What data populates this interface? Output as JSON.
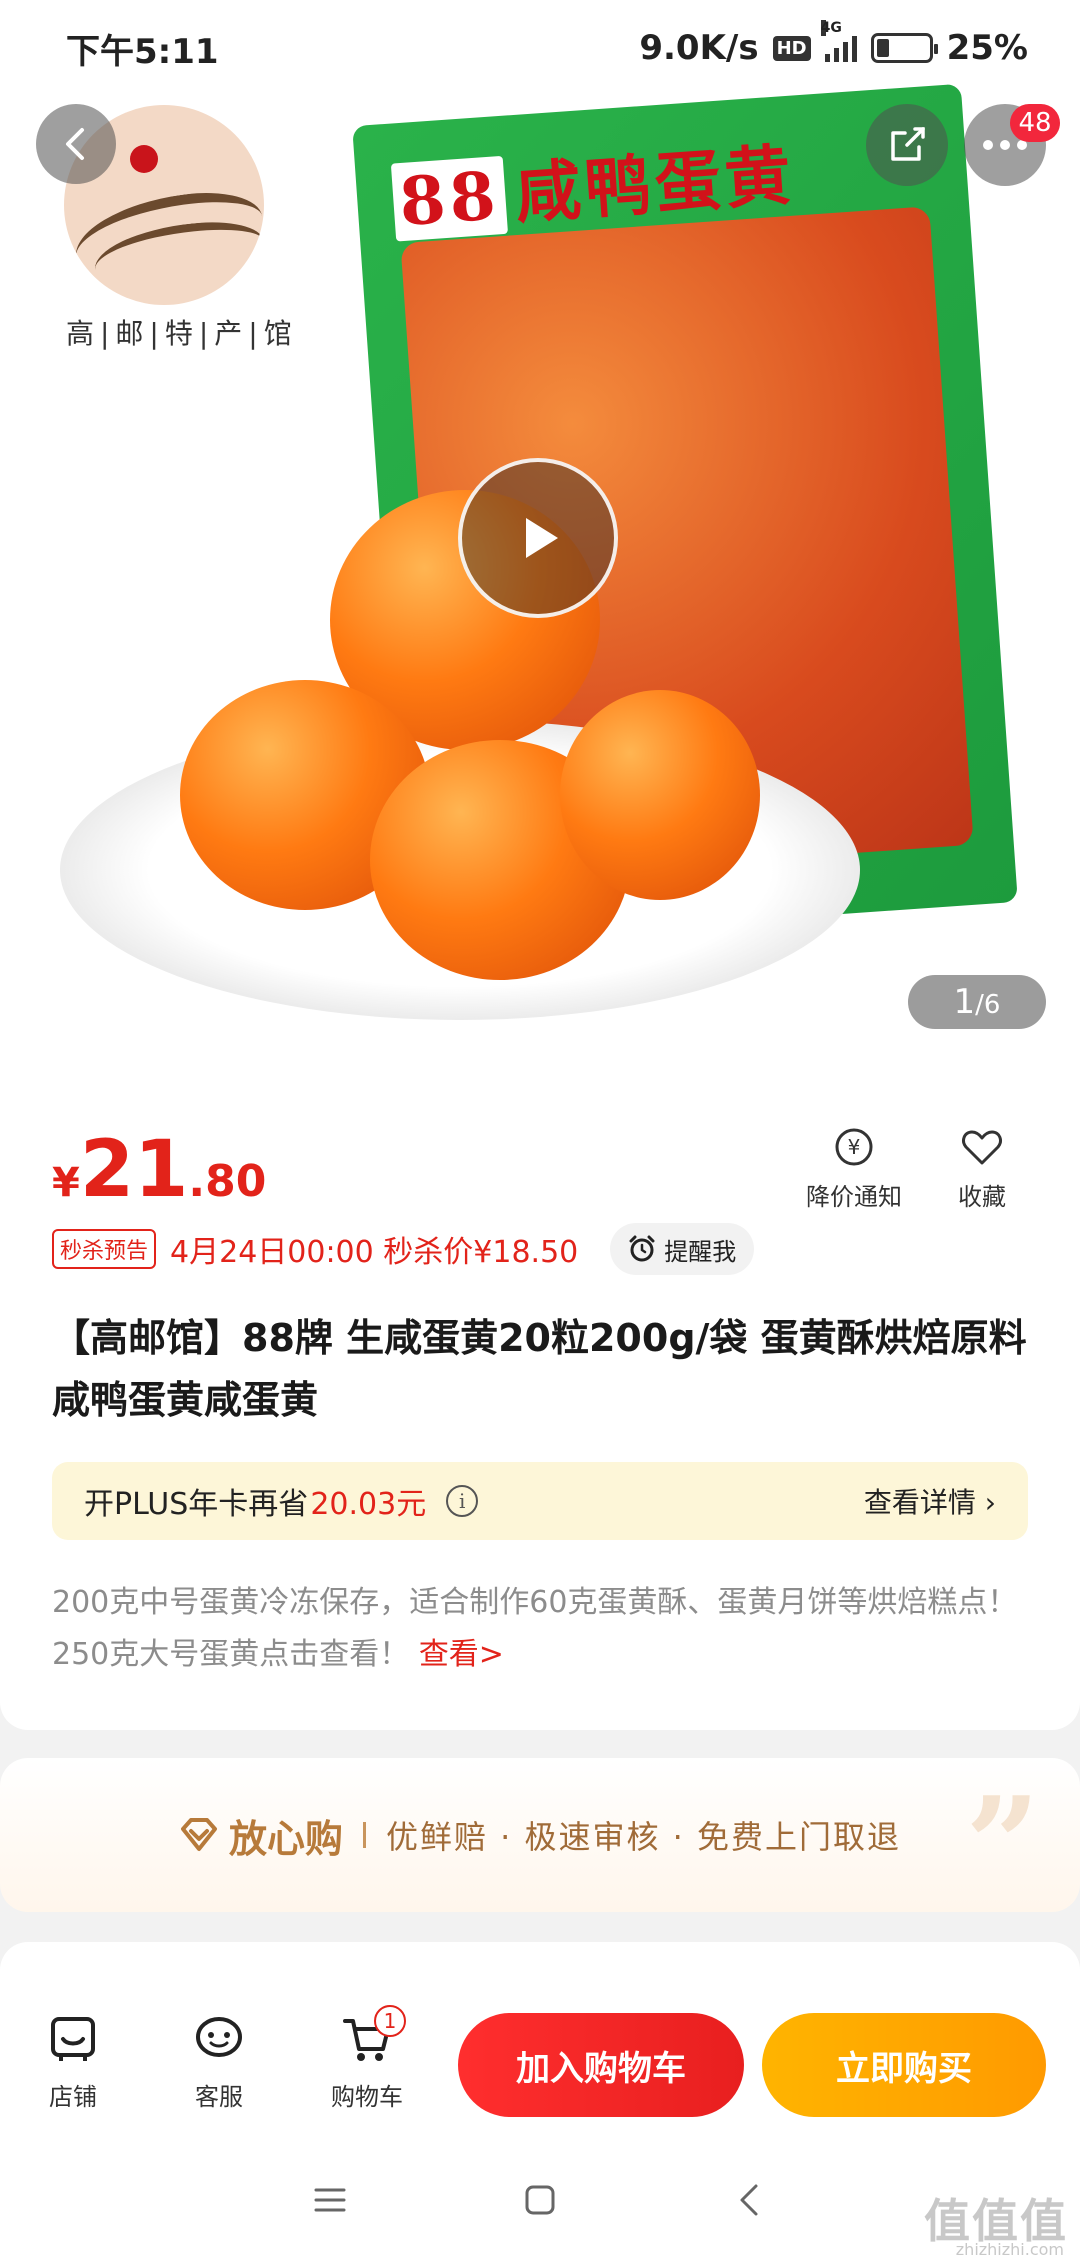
{
  "status_bar": {
    "time": "下午5:11",
    "net_speed": "9.0K/s",
    "hd": "HD",
    "network": "4G",
    "battery": "25%",
    "battery_level": 0.25
  },
  "hero": {
    "store_logo_text": "高|邮|特|产|馆",
    "bag_brand": "88",
    "bag_title": "咸鸭蛋黄",
    "more_badge": "48",
    "page_current": "1",
    "page_total": "/6"
  },
  "product": {
    "price_symbol": "¥",
    "price_int": "21",
    "price_dec": ".80",
    "price_notice": "降价通知",
    "favorite": "收藏",
    "flash_tag": "秒杀预告",
    "flash_text": "4月24日00:00 秒杀价¥18.50",
    "remind": "提醒我",
    "title": "【高邮馆】88牌 生咸蛋黄20粒200g/袋 蛋黄酥烘焙原料咸鸭蛋黄咸蛋黄",
    "plus_prefix": "开PLUS年卡再省",
    "plus_amount": "20.03元",
    "plus_details": "查看详情 ›",
    "description": "200克中号蛋黄冷冻保存，适合制作60克蛋黄酥、蛋黄月饼等烘焙糕点！250克大号蛋黄点击查看！",
    "description_link": "查看>"
  },
  "assurance": {
    "brand": "放心购",
    "items": "优鲜赔 · 极速审核 · 免费上门取退"
  },
  "bottom_bar": {
    "store": "店铺",
    "service": "客服",
    "cart": "购物车",
    "cart_count": "1",
    "add_to_cart": "加入购物车",
    "buy_now": "立即购买"
  },
  "watermark": {
    "text": "值值值",
    "sub": "zhizhizhi.com"
  },
  "colors": {
    "accent_red": "#e2231a",
    "buy_orange": "#ffa600",
    "plus_bg": "#fdf6d8",
    "assurance_gold": "#b77a3a"
  }
}
